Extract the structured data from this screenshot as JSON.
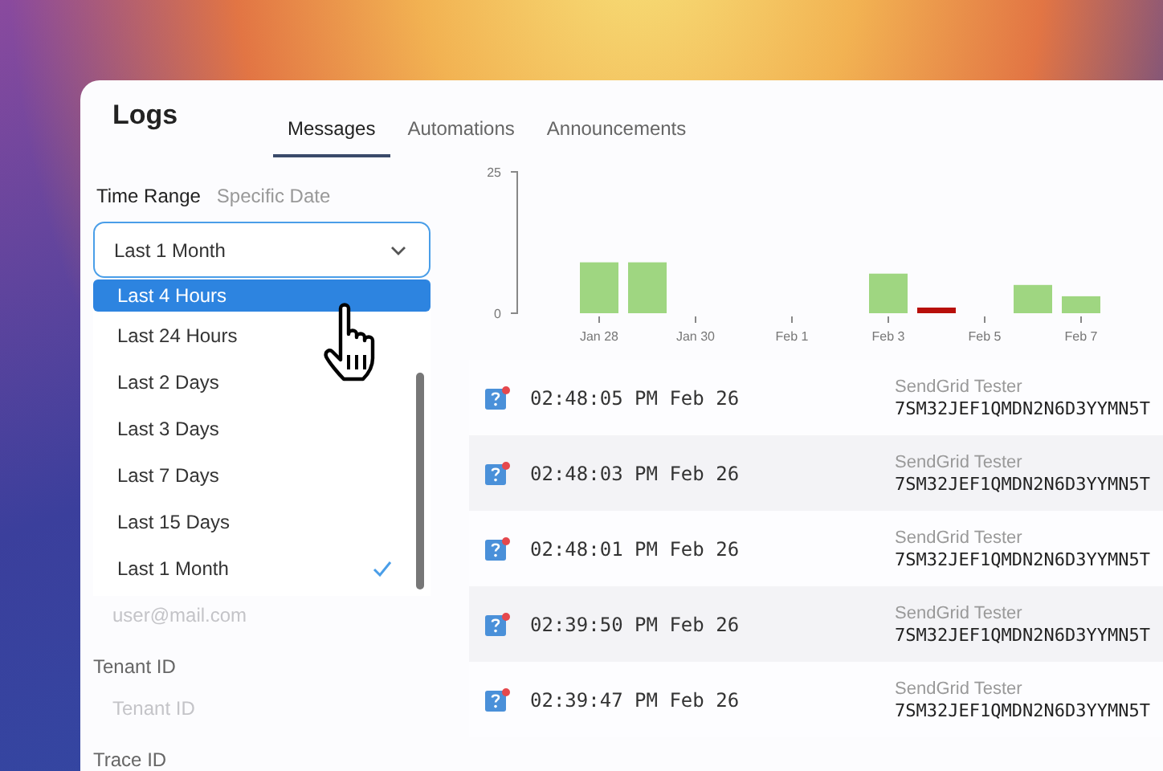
{
  "window": {
    "title": "Logs"
  },
  "tabs": [
    {
      "label": "Messages",
      "selected": true
    },
    {
      "label": "Automations",
      "selected": false
    },
    {
      "label": "Announcements",
      "selected": false
    }
  ],
  "filters": {
    "mode_tabs": [
      {
        "label": "Time Range",
        "selected": true
      },
      {
        "label": "Specific Date",
        "selected": false
      }
    ],
    "time_range": {
      "value": "Last 1 Month",
      "expanded": true,
      "options": [
        {
          "label": "Last 4 Hours",
          "highlighted": true,
          "selected": false
        },
        {
          "label": "Last 24 Hours",
          "highlighted": false,
          "selected": false
        },
        {
          "label": "Last 2 Days",
          "highlighted": false,
          "selected": false
        },
        {
          "label": "Last 3 Days",
          "highlighted": false,
          "selected": false
        },
        {
          "label": "Last 7 Days",
          "highlighted": false,
          "selected": false
        },
        {
          "label": "Last 15 Days",
          "highlighted": false,
          "selected": false
        },
        {
          "label": "Last 1 Month",
          "highlighted": false,
          "selected": true
        }
      ]
    },
    "email": {
      "placeholder": "user@mail.com"
    },
    "tenant_id": {
      "label": "Tenant ID",
      "placeholder": "Tenant ID"
    },
    "trace_id": {
      "label": "Trace ID"
    }
  },
  "activity_chart": {
    "chart_data": {
      "type": "bar",
      "stacked": true,
      "categories": [
        "Jan 28",
        null,
        "Jan 30",
        null,
        "Feb 1",
        null,
        "Feb 3",
        null,
        "Feb 5",
        null,
        "Feb 7"
      ],
      "series": [
        {
          "color": "#9fd681",
          "values": [
            9,
            9,
            null,
            null,
            null,
            null,
            7,
            null,
            null,
            5,
            3
          ]
        },
        {
          "color": "#b80f0a",
          "values": [
            null,
            null,
            null,
            null,
            null,
            null,
            null,
            1,
            null,
            null,
            null
          ]
        }
      ],
      "ylim": [
        0,
        25
      ],
      "yticks": [
        0,
        25
      ]
    }
  },
  "messages": [
    {
      "time": "02:48:05 PM Feb 26",
      "sender": "SendGrid Tester",
      "id": "7SM32JEF1QMDN2N6D3YYMN5T"
    },
    {
      "time": "02:48:03 PM Feb 26",
      "sender": "SendGrid Tester",
      "id": "7SM32JEF1QMDN2N6D3YYMN5T"
    },
    {
      "time": "02:48:01 PM Feb 26",
      "sender": "SendGrid Tester",
      "id": "7SM32JEF1QMDN2N6D3YYMN5T"
    },
    {
      "time": "02:39:50 PM Feb 26",
      "sender": "SendGrid Tester",
      "id": "7SM32JEF1QMDN2N6D3YYMN5T"
    },
    {
      "time": "02:39:47 PM Feb 26",
      "sender": "SendGrid Tester",
      "id": "7SM32JEF1QMDN2N6D3YYMN5T"
    }
  ]
}
